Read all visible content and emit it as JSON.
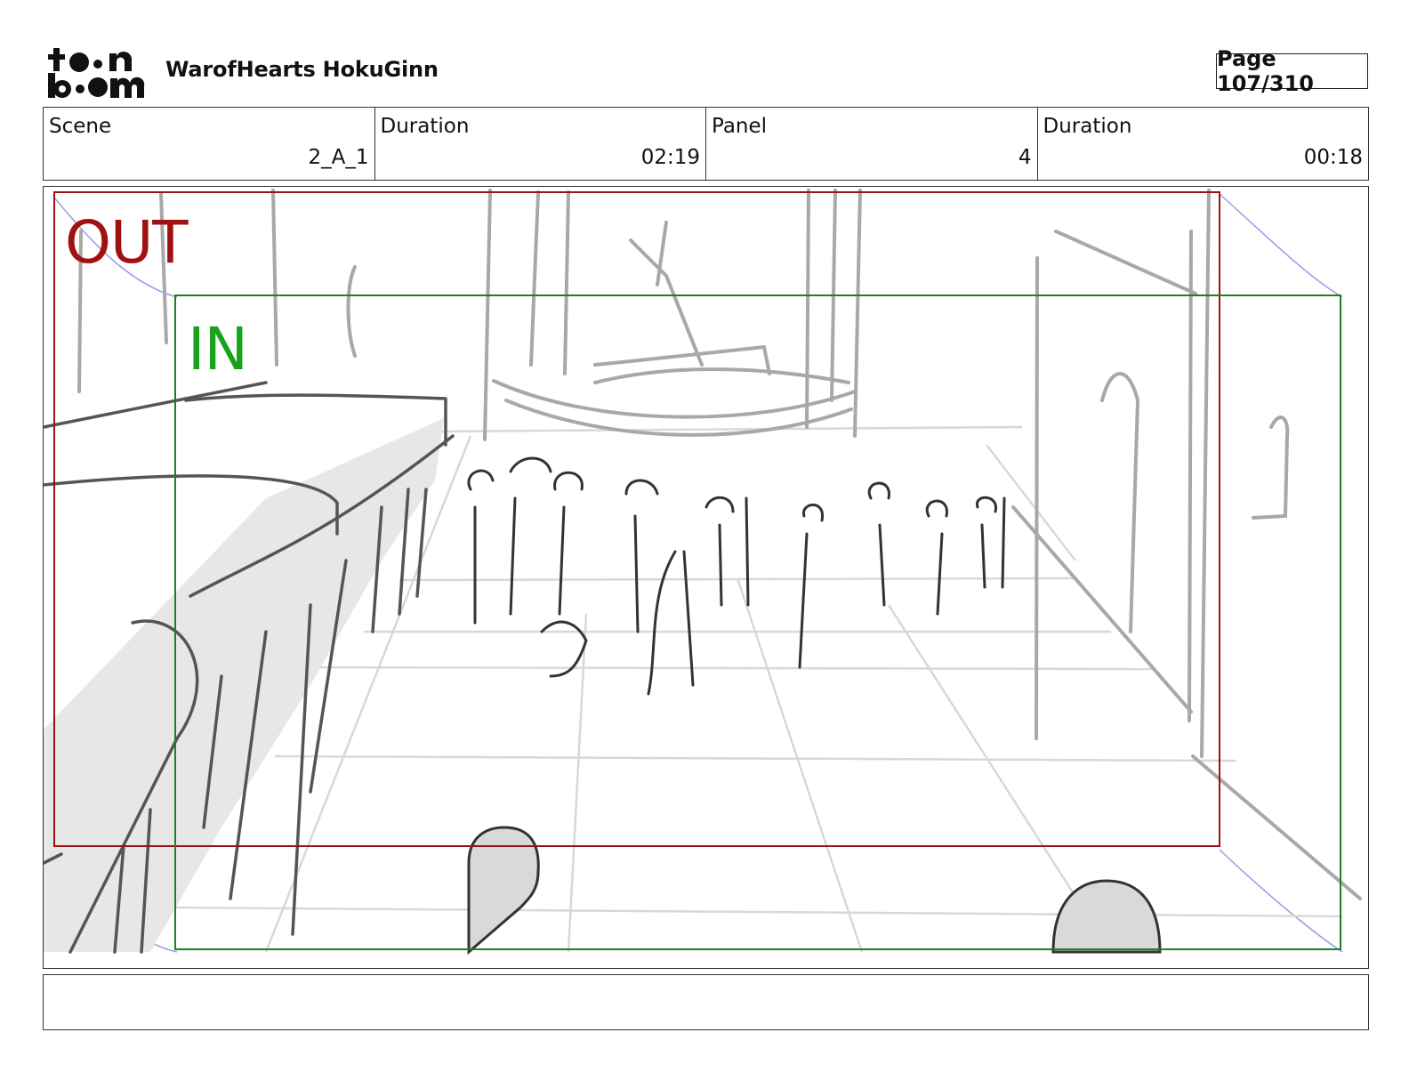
{
  "header": {
    "logo_text": "toon boom",
    "project_title": "WarofHearts HokuGinn",
    "page_label": "Page 107/310"
  },
  "info": {
    "scene_label": "Scene",
    "scene_value": "2_A_1",
    "scene_duration_label": "Duration",
    "scene_duration_value": "02:19",
    "panel_label": "Panel",
    "panel_value": "4",
    "panel_duration_label": "Duration",
    "panel_duration_value": "00:18"
  },
  "panel_frame": {
    "out_label": "OUT",
    "in_label": "IN",
    "out_color": "#a01212",
    "in_color": "#17a31a"
  },
  "notes": {
    "text": ""
  }
}
